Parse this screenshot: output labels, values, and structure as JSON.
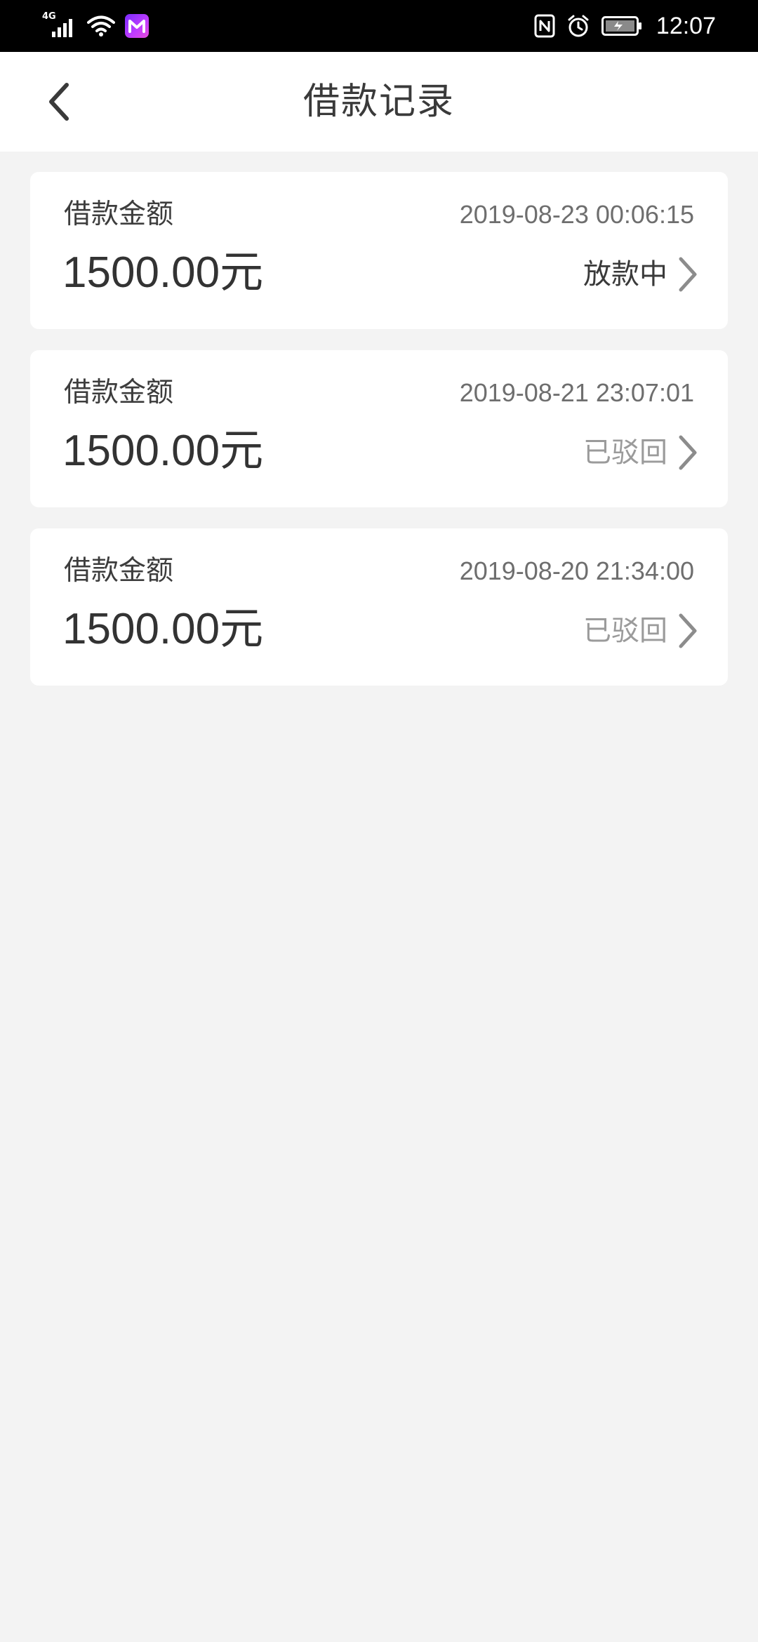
{
  "status_bar": {
    "network_type": "4G",
    "time": "12:07",
    "icons": [
      "signal-icon",
      "wifi-icon",
      "app-m-icon",
      "nfc-icon",
      "alarm-icon",
      "battery-charging-icon"
    ]
  },
  "header": {
    "title": "借款记录",
    "back_icon": "chevron-left-icon"
  },
  "records": [
    {
      "label": "借款金额",
      "date": "2019-08-23 00:06:15",
      "amount": "1500.00元",
      "status": "放款中",
      "status_color": "#3a3a3a"
    },
    {
      "label": "借款金额",
      "date": "2019-08-21 23:07:01",
      "amount": "1500.00元",
      "status": "已驳回",
      "status_color": "#9b9b9b"
    },
    {
      "label": "借款金额",
      "date": "2019-08-20 21:34:00",
      "amount": "1500.00元",
      "status": "已驳回",
      "status_color": "#9b9b9b"
    }
  ],
  "colors": {
    "background": "#f3f3f3",
    "card": "#ffffff",
    "status_bar": "#000000",
    "app_badge": "#9b33ff"
  }
}
